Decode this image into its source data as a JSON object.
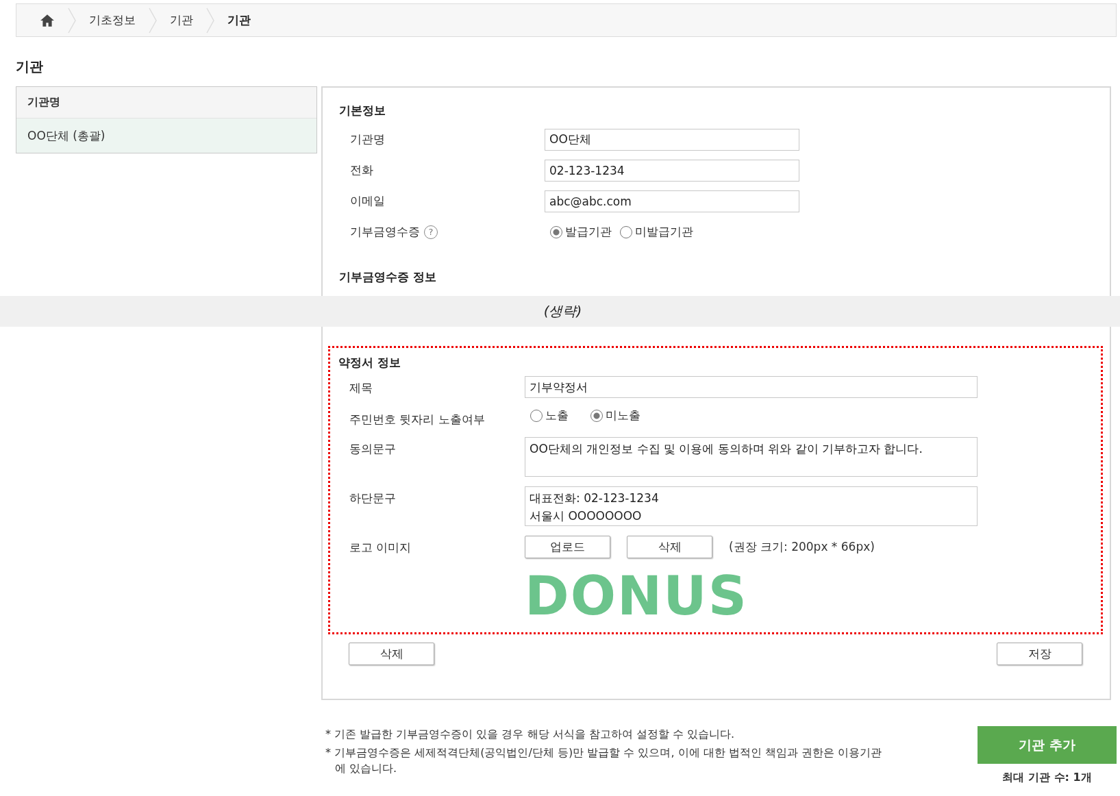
{
  "breadcrumb": [
    {
      "label": "기초정보",
      "current": false
    },
    {
      "label": "기관",
      "current": false
    },
    {
      "label": "기관",
      "current": true
    }
  ],
  "page_title": "기관",
  "org_list": {
    "header": "기관명",
    "items": [
      {
        "label": "OO단체 (총괄)",
        "selected": true
      }
    ]
  },
  "basic_info": {
    "title": "기본정보",
    "fields": [
      {
        "label": "기관명",
        "value": "OO단체"
      },
      {
        "label": "전화",
        "value": "02-123-1234"
      },
      {
        "label": "이메일",
        "value": "abc@abc.com"
      }
    ],
    "receipt": {
      "label": "기부금영수증",
      "help": "?",
      "options": [
        {
          "label": "발급기관",
          "selected": true
        },
        {
          "label": "미발급기관",
          "selected": false
        }
      ]
    }
  },
  "receipt_info": {
    "title": "기부금영수증 정보"
  },
  "omitted_note": "(생략)",
  "agreement": {
    "title": "약정서 정보",
    "subject": {
      "label": "제목",
      "value": "기부약정서"
    },
    "ssn_display": {
      "label": "주민번호 뒷자리 노출여부",
      "options": [
        {
          "label": "노출",
          "selected": false
        },
        {
          "label": "미노출",
          "selected": true
        }
      ]
    },
    "consent": {
      "label": "동의문구",
      "value": "OO단체의 개인정보 수집 및 이용에 동의하며 위와 같이 기부하고자 합니다."
    },
    "footer_text": {
      "label": "하단문구",
      "value": "대표전화: 02-123-1234\n서울시 OOOOOOOO"
    },
    "logo": {
      "label": "로고 이미지",
      "buttons": [
        "업로드",
        "삭제"
      ],
      "hint": "(권장 크기: 200px * 66px)",
      "logo_text": "DONUS"
    }
  },
  "actions": [
    "삭제",
    "저장"
  ],
  "notes": [
    "* 기존 발급한 기부금영수증이 있을 경우 해당 서식을 참고하여 설정할 수 있습니다.",
    "* 기부금영수증은 세제적격단체(공익법인/단체 등)만 발급할 수 있으며, 이에 대한 법적인 책임과 권한은 이용기관에 있습니다."
  ],
  "add_button": "기관 추가",
  "max_count": "최대 기관 수: 1개"
}
